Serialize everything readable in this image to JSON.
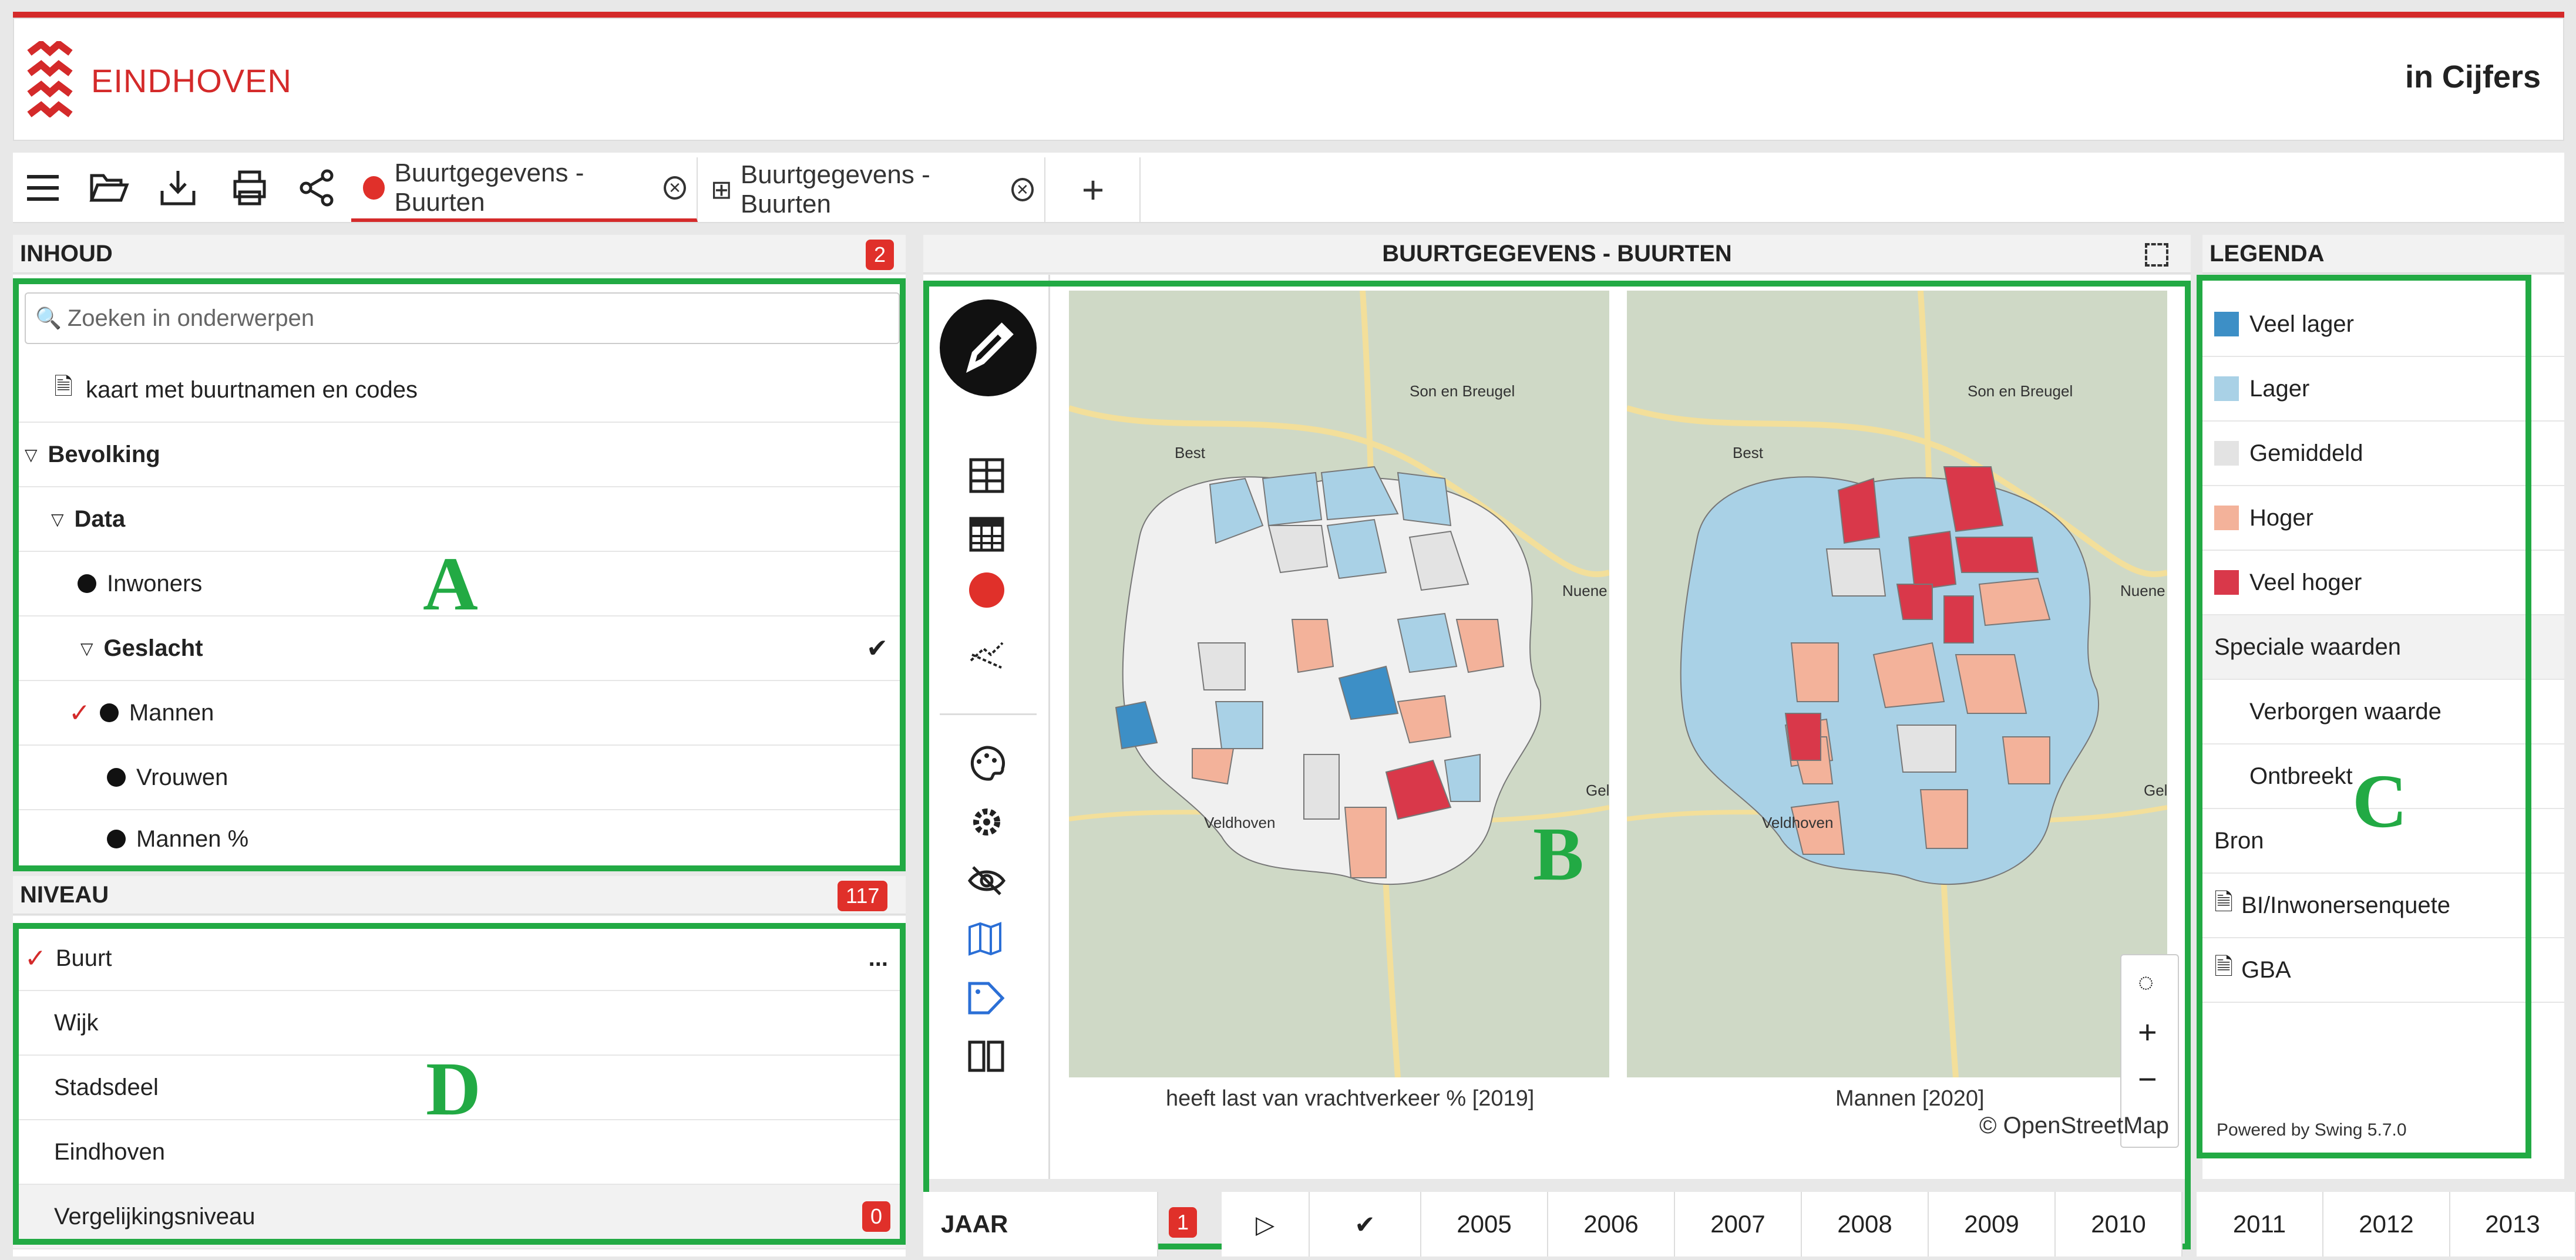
{
  "header": {
    "brand": "EINDHOVEN",
    "right": "in Cijfers"
  },
  "toolbar": {
    "icons": [
      "menu-icon",
      "folder-open-icon",
      "download-icon",
      "print-icon",
      "share-icon"
    ]
  },
  "tabs": [
    {
      "label": "Buurtgegevens - Buurten",
      "icon": "globe-icon",
      "active": true
    },
    {
      "label": "Buurtgegevens - Buurten",
      "icon": "table-icon",
      "active": false
    },
    {
      "label": "+"
    }
  ],
  "inhoud": {
    "title": "INHOUD",
    "badge": "2",
    "search_placeholder": "Zoeken in onderwerpen",
    "items": [
      {
        "label": "kaart met buurtnamen en codes",
        "type": "doc"
      },
      {
        "label": "Bevolking",
        "type": "folder",
        "level": 0
      },
      {
        "label": "Data",
        "type": "folder",
        "level": 1
      },
      {
        "label": "Inwoners",
        "type": "leaf",
        "level": 2
      },
      {
        "label": "Geslacht",
        "type": "folder",
        "level": 2
      },
      {
        "label": "Mannen",
        "type": "leaf",
        "level": 3,
        "checked": true
      },
      {
        "label": "Vrouwen",
        "type": "leaf",
        "level": 3
      },
      {
        "label": "Mannen %",
        "type": "leaf",
        "level": 3
      }
    ]
  },
  "niveau": {
    "title": "NIVEAU",
    "badge": "117",
    "items": [
      "Buurt",
      "Wijk",
      "Stadsdeel",
      "Eindhoven"
    ],
    "more": "...",
    "vergelijking": "Vergelijkingsniveau",
    "vergelijking_badge": "0"
  },
  "map": {
    "title": "BUURTGEGEVENS - BUURTEN",
    "caption_left": "heeft last van vrachtverkeer % [2019]",
    "caption_right": "Mannen [2020]",
    "attribution": "© OpenStreetMap",
    "places_left": [
      "Son en Breugel",
      "Best",
      "Nuene",
      "Veldhoven",
      "Gel"
    ],
    "places_right": [
      "Son en Breugel",
      "Best",
      "Nuene",
      "Veldhoven",
      "Gel"
    ],
    "zoom_in": "+",
    "zoom_out": "−"
  },
  "legenda": {
    "title": "LEGENDA",
    "items": [
      {
        "label": "Veel lager",
        "color": "#3d8fc6"
      },
      {
        "label": "Lager",
        "color": "#a9d1e6"
      },
      {
        "label": "Gemiddeld",
        "color": "#e3e3e3"
      },
      {
        "label": "Hoger",
        "color": "#f3b29a"
      },
      {
        "label": "Veel hoger",
        "color": "#d9384a"
      }
    ],
    "special": "Speciale waarden",
    "special_items": [
      "Verborgen waarde",
      "Ontbreekt"
    ],
    "bron": "Bron",
    "bron_items": [
      "BI/Inwonersenquete",
      "GBA"
    ],
    "powered": "Powered by Swing 5.7.0"
  },
  "jaar": {
    "title": "JAAR",
    "badge": "1",
    "years": [
      "2005",
      "2006",
      "2007",
      "2008",
      "2009",
      "2010",
      "2011",
      "2012",
      "2013"
    ]
  },
  "annotations": {
    "a": "A",
    "b": "B",
    "c": "C",
    "d": "D"
  }
}
